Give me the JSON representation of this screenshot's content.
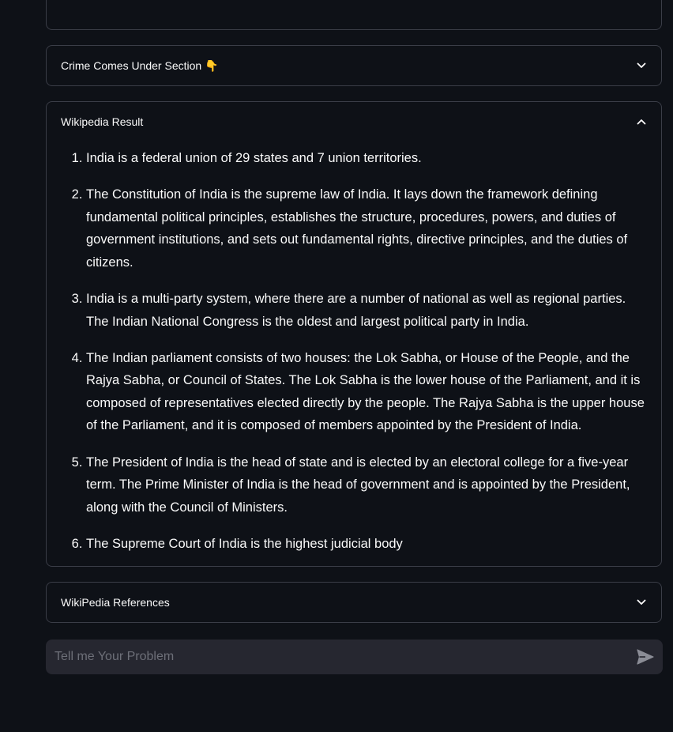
{
  "expanders": {
    "crime": {
      "title": "Crime Comes Under Section",
      "emoji": "👇"
    },
    "wiki": {
      "title": "Wikipedia Result",
      "items": [
        "India is a federal union of 29 states and 7 union territories.",
        "The Constitution of India is the supreme law of India. It lays down the framework defining fundamental political principles, establishes the structure, procedures, powers, and duties of government institutions, and sets out fundamental rights, directive principles, and the duties of citizens.",
        "India is a multi-party system, where there are a number of national as well as regional parties. The Indian National Congress is the oldest and largest political party in India.",
        "The Indian parliament consists of two houses: the Lok Sabha, or House of the People, and the Rajya Sabha, or Council of States. The Lok Sabha is the lower house of the Parliament, and it is composed of representatives elected directly by the people. The Rajya Sabha is the upper house of the Parliament, and it is composed of members appointed by the President of India.",
        "The President of India is the head of state and is elected by an electoral college for a five-year term. The Prime Minister of India is the head of government and is appointed by the President, along with the Council of Ministers.",
        "The Supreme Court of India is the highest judicial body"
      ]
    },
    "refs": {
      "title": "WikiPedia References"
    }
  },
  "chat": {
    "placeholder": "Tell me Your Problem"
  },
  "icons": {
    "expand": "chevron-down-icon",
    "collapse": "chevron-up-icon",
    "send": "send-icon"
  },
  "colors": {
    "background": "#0e1117",
    "border": "#3a3d47",
    "input_bg": "#262730",
    "text": "#fafafa",
    "placeholder": "#6d6f78"
  }
}
